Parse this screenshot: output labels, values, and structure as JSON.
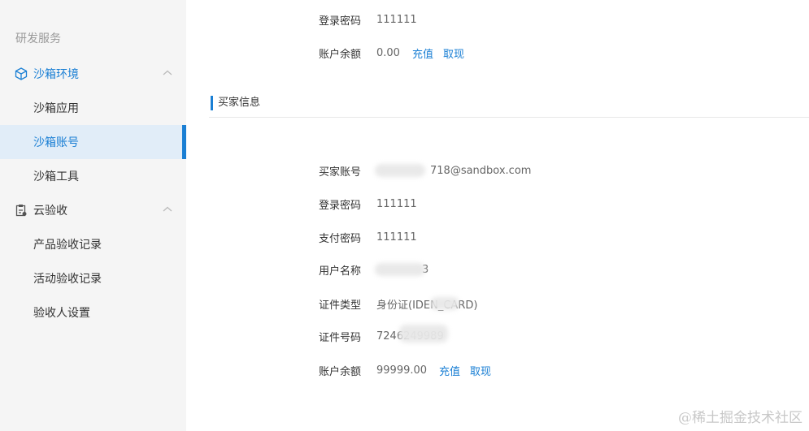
{
  "sidebar": {
    "section_title": "研发服务",
    "groups": [
      {
        "label": "沙箱环境",
        "icon": "cube-icon",
        "items": [
          "沙箱应用",
          "沙箱账号",
          "沙箱工具"
        ],
        "active_item": "沙箱账号"
      },
      {
        "label": "云验收",
        "icon": "clipboard-icon",
        "items": [
          "产品验收记录",
          "活动验收记录",
          "验收人设置"
        ]
      }
    ]
  },
  "seller": {
    "password_label": "登录密码",
    "password_value": "111111",
    "balance_label": "账户余额",
    "balance_value": "0.00",
    "recharge": "充值",
    "withdraw": "取现"
  },
  "buyer": {
    "heading": "买家信息",
    "account_label": "买家账号",
    "account_value": "718@sandbox.com",
    "login_password_label": "登录密码",
    "login_password_value": "111111",
    "pay_password_label": "支付密码",
    "pay_password_value": "111111",
    "username_label": "用户名称",
    "username_value": "3",
    "id_type_label": "证件类型",
    "id_type_value": "身份证(IDEN_CARD)",
    "id_number_label": "证件号码",
    "id_number_value": "7246249989",
    "balance_label": "账户余额",
    "balance_value": "99999.00",
    "recharge": "充值",
    "withdraw": "取现"
  },
  "watermark": "@稀土掘金技术社区",
  "colors": {
    "accent": "#1a7fd4",
    "active_bg": "#e1edf8",
    "sidebar_bg": "#f5f5f5"
  }
}
